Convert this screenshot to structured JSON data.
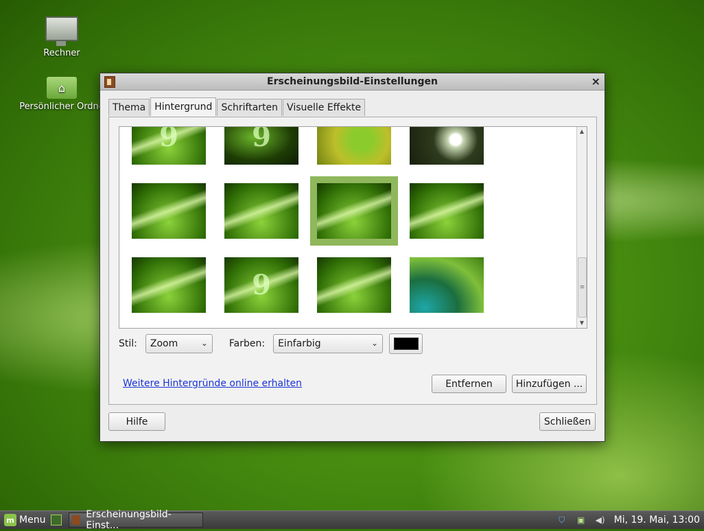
{
  "desktop": {
    "icons": [
      {
        "label": "Rechner"
      },
      {
        "label": "Persönlicher Ordne"
      }
    ]
  },
  "window": {
    "title": "Erscheinungsbild-Einstellungen",
    "close_glyph": "×",
    "tabs": [
      {
        "label": "Thema"
      },
      {
        "label": "Hintergrund"
      },
      {
        "label": "Schriftarten"
      },
      {
        "label": "Visuelle Effekte"
      }
    ],
    "active_tab": "Hintergrund",
    "gallery": {
      "selected_index": 6,
      "scroll_fraction": 0.78
    },
    "controls": {
      "style_label": "Stil:",
      "style_value": "Zoom",
      "colors_label": "Farben:",
      "colors_value": "Einfarbig",
      "color_swatch": "#000000"
    },
    "link_more": "Weitere Hintergründe online erhalten",
    "btn_remove": "Entfernen",
    "btn_add": "Hinzufügen ...",
    "btn_help": "Hilfe",
    "btn_close": "Schließen"
  },
  "taskbar": {
    "menu_label": "Menu",
    "task_label": "Erscheinungsbild-Einst...",
    "clock": "Mi, 19. Mai, 13:00"
  },
  "colors": {
    "link": "#1a33d6",
    "selection": "#8fb75c"
  }
}
